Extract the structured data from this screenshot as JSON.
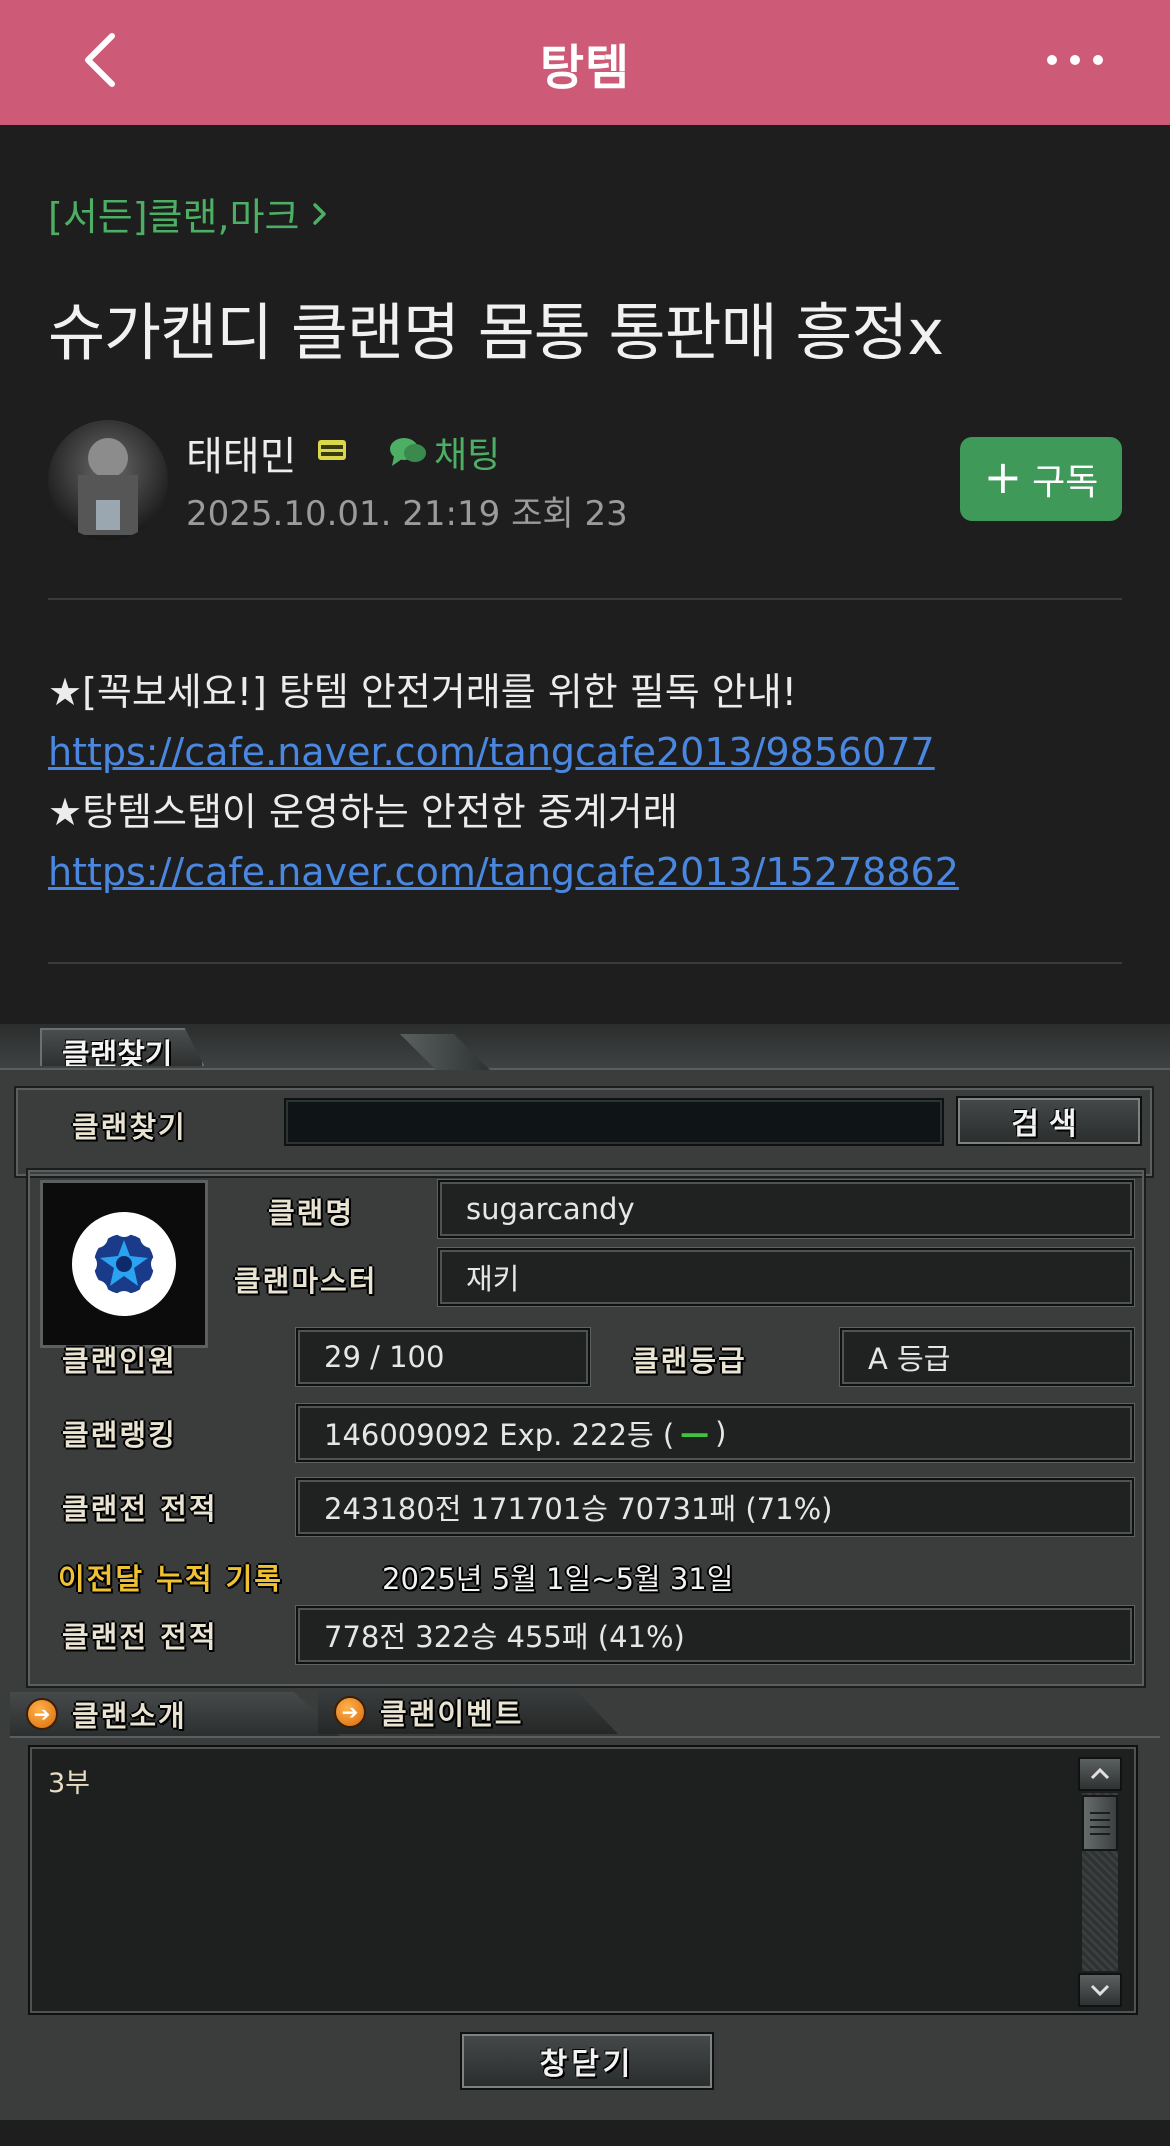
{
  "app_bar": {
    "title": "탕템",
    "back_icon": "chevron-left-icon",
    "more_icon": "more-horizontal-icon",
    "bg_color": "#cd5a76"
  },
  "post": {
    "board": "[서든]클랜,마크",
    "title": "슈가캔디 클랜명 몸통 통판매 흥정x",
    "author": {
      "name": "태태민",
      "chat_label": "채팅",
      "meta": "2025.10.01. 21:19  조회 23"
    },
    "subscribe_label": "구독",
    "body": {
      "line1": "★[꼭보세요!] 탕템 안전거래를 위한 필독 안내!",
      "link1": "https://cafe.naver.com/tangcafe2013/9856077",
      "line2": "★탕템스탭이 운영하는 안전한 중계거래",
      "link2": "https://cafe.naver.com/tangcafe2013/15278862"
    }
  },
  "game": {
    "tab_title": "클랜찾기",
    "search_label": "클랜찾기",
    "search_value": "",
    "search_button": "검색",
    "clan_name_label": "클랜명",
    "clan_name": "sugarcandy",
    "clan_master_label": "클랜마스터",
    "clan_master": "재키",
    "members_label": "클랜인원",
    "members": "29 / 100",
    "grade_label": "클랜등급",
    "grade": "A 등급",
    "ranking_label": "클랜랭킹",
    "ranking_prefix": "146009092 Exp.  222등 ( ",
    "ranking_change": "—",
    "ranking_suffix": " )",
    "record_label": "클랜전 전적",
    "record": "243180전  171701승  70731패  (71%)",
    "last_month_label": "이전달 누적 기록",
    "last_month_period": "2025년 5월 1일~5월 31일",
    "last_record_label": "클랜전 전적",
    "last_record": "778전  322승  455패  (41%)",
    "tab_intro": "클랜소개",
    "tab_event": "클랜이벤트",
    "intro_text": "3부",
    "close_button": "창닫기",
    "accent_gold": "#f0c233",
    "ranking_change_color": "#3ec43e"
  }
}
